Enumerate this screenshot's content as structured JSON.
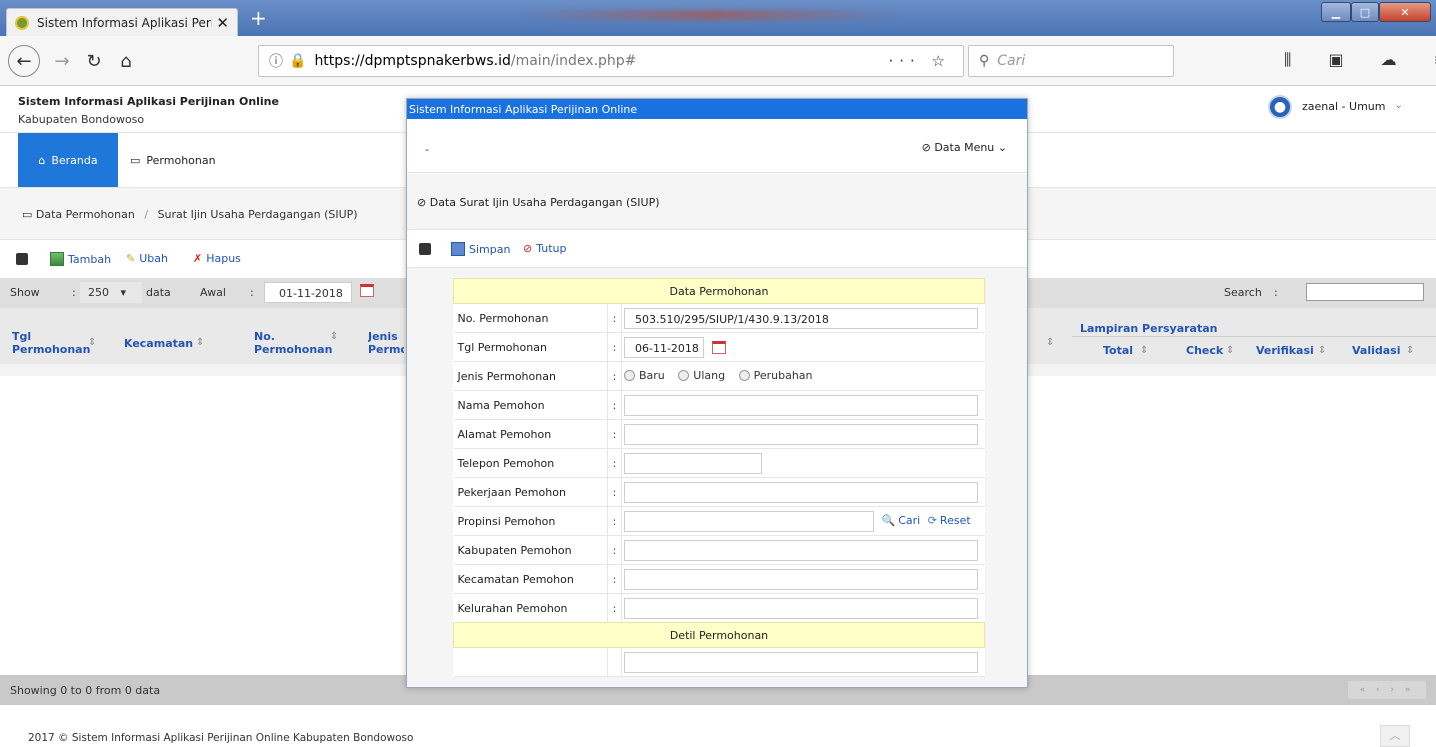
{
  "browser": {
    "tab_title": "Sistem Informasi Aplikasi Perijin",
    "url_host": "https://dpmptspnakerbws.id",
    "url_path": "/main/index.php#",
    "search_placeholder": "Cari"
  },
  "app": {
    "title": "Sistem Informasi Aplikasi Perijinan Online",
    "subtitle": "Kabupaten Bondowoso",
    "user": "zaenal - Umum"
  },
  "menu": {
    "beranda": "Beranda",
    "permohonan": "Permohonan"
  },
  "breadcrumb": {
    "root": "Data Permohonan",
    "current": "Surat Ijin Usaha Perdagangan (SIUP)"
  },
  "toolbar": {
    "tambah": "Tambah",
    "ubah": "Ubah",
    "hapus": "Hapus"
  },
  "filter": {
    "show_label": "Show",
    "show_value": "250",
    "data_label": "data",
    "awal_label": "Awal",
    "awal_value": "01-11-2018",
    "search_label": "Search"
  },
  "table": {
    "col_tgl": "Tgl Permohonan",
    "col_kecamatan": "Kecamatan",
    "col_no": "No. Permohonan",
    "col_jenis": "Jenis Permo",
    "lampiran": "Lampiran Persyaratan",
    "col_total": "Total",
    "col_check": "Check",
    "col_verifikasi": "Verifikasi",
    "col_validasi": "Validasi"
  },
  "footer": {
    "count": "Showing 0 to 0 from 0 data",
    "copyright": "2017 © Sistem Informasi Aplikasi Perijinan Online Kabupaten Bondowoso"
  },
  "modal": {
    "title": "Sistem Informasi Aplikasi Perijinan Online",
    "dash": "-",
    "data_menu": "Data Menu",
    "subtitle": "Data Surat Ijin Usaha Perdagangan (SIUP)",
    "simpan": "Simpan",
    "tutup": "Tutup",
    "section1": "Data Permohonan",
    "section2": "Detil Permohonan",
    "labels": {
      "no": "No. Permohonan",
      "tgl": "Tgl Permohonan",
      "jenis": "Jenis Permohonan",
      "nama": "Nama Pemohon",
      "alamat": "Alamat Pemohon",
      "telepon": "Telepon Pemohon",
      "pekerjaan": "Pekerjaan Pemohon",
      "propinsi": "Propinsi Pemohon",
      "kabupaten": "Kabupaten Pemohon",
      "kecamatan": "Kecamatan Pemohon",
      "kelurahan": "Kelurahan Pemohon"
    },
    "values": {
      "no": "503.510/295/SIUP/1/430.9.13/2018",
      "tgl": "06-11-2018"
    },
    "radio": {
      "baru": "Baru",
      "ulang": "Ulang",
      "perubahan": "Perubahan"
    },
    "cari": "Cari",
    "reset": "Reset"
  }
}
